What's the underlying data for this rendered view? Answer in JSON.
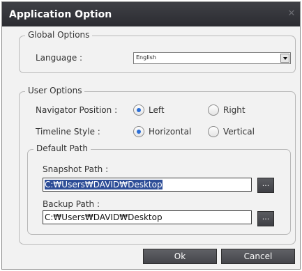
{
  "window": {
    "title": "Application Option",
    "close_glyph": "✕"
  },
  "global_options": {
    "legend": "Global Options",
    "language_label": "Language :",
    "language_value": "English"
  },
  "user_options": {
    "legend": "User Options",
    "navigator_position": {
      "label": "Navigator Position :",
      "options": [
        {
          "label": "Left",
          "checked": true
        },
        {
          "label": "Right",
          "checked": false
        }
      ]
    },
    "timeline_style": {
      "label": "Timeline Style :",
      "options": [
        {
          "label": "Horizontal",
          "checked": true
        },
        {
          "label": "Vertical",
          "checked": false
        }
      ]
    },
    "default_path": {
      "legend": "Default Path",
      "snapshot_label": "Snapshot Path :",
      "snapshot_value": "C:₩Users₩DAVID₩Desktop",
      "backup_label": "Backup Path :",
      "backup_value": "C:₩Users₩DAVID₩Desktop",
      "browse_label": "..."
    }
  },
  "buttons": {
    "ok": "Ok",
    "cancel": "Cancel"
  },
  "colors": {
    "title_bar": "#2f3035",
    "radio_dot": "#2c6fd6",
    "selection": "#2d4d97"
  }
}
